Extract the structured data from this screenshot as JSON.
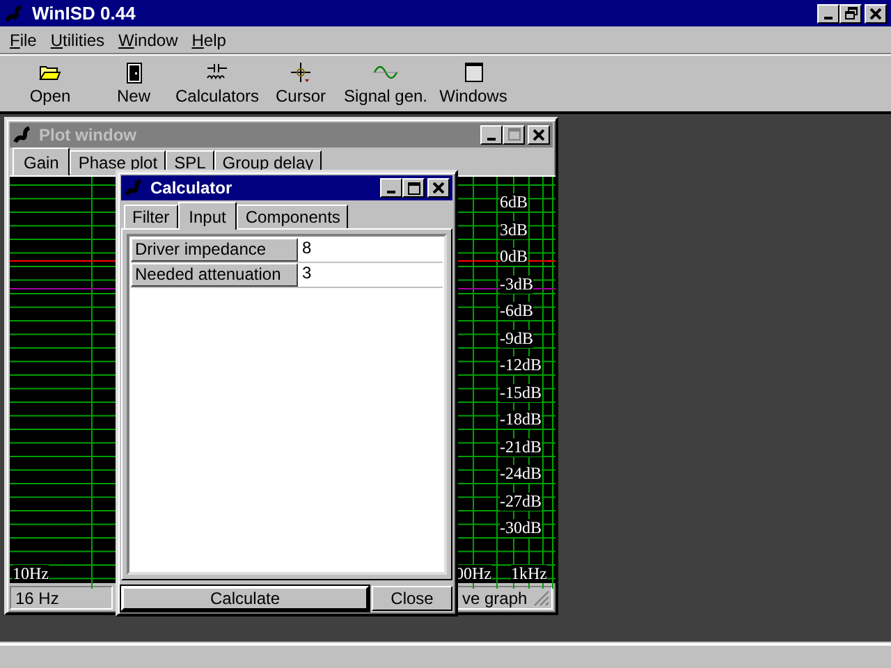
{
  "app_window": {
    "title": "WinISD 0.44"
  },
  "menu": [
    "File",
    "Utilities",
    "Window",
    "Help"
  ],
  "toolbar": [
    {
      "label": "Open",
      "kind": "folder"
    },
    {
      "label": "New",
      "kind": "door"
    },
    {
      "label": "Calculators",
      "kind": "capacitor"
    },
    {
      "label": "Cursor",
      "kind": "crosshair"
    },
    {
      "label": "Signal gen.",
      "kind": "wave"
    },
    {
      "label": "Windows",
      "kind": "window"
    }
  ],
  "plot_window": {
    "title": "Plot window",
    "active": false,
    "tabs": [
      {
        "label": "Gain",
        "selected": true
      },
      {
        "label": "Phase plot",
        "selected": false
      },
      {
        "label": "SPL",
        "selected": false
      },
      {
        "label": "Group delay",
        "selected": false
      }
    ],
    "y_labels": [
      "6dB",
      "3dB",
      "0dB",
      "-3dB",
      "-6dB",
      "-9dB",
      "-12dB",
      "-15dB",
      "-18dB",
      "-21dB",
      "-24dB",
      "-27dB",
      "-30dB"
    ],
    "x_labels": [
      "10Hz",
      "00Hz",
      "1kHz"
    ],
    "status": [
      "16 Hz",
      "ve graph"
    ]
  },
  "calculator": {
    "title": "Calculator",
    "active": true,
    "tabs": [
      {
        "label": "Filter",
        "selected": false
      },
      {
        "label": "Input",
        "selected": true
      },
      {
        "label": "Components",
        "selected": false
      }
    ],
    "fields": [
      {
        "label": "Driver impedance",
        "value": "8"
      },
      {
        "label": "Needed attenuation",
        "value": "3"
      }
    ],
    "buttons": [
      {
        "label": "Calculate",
        "default": true
      },
      {
        "label": "Close",
        "default": false
      }
    ]
  }
}
